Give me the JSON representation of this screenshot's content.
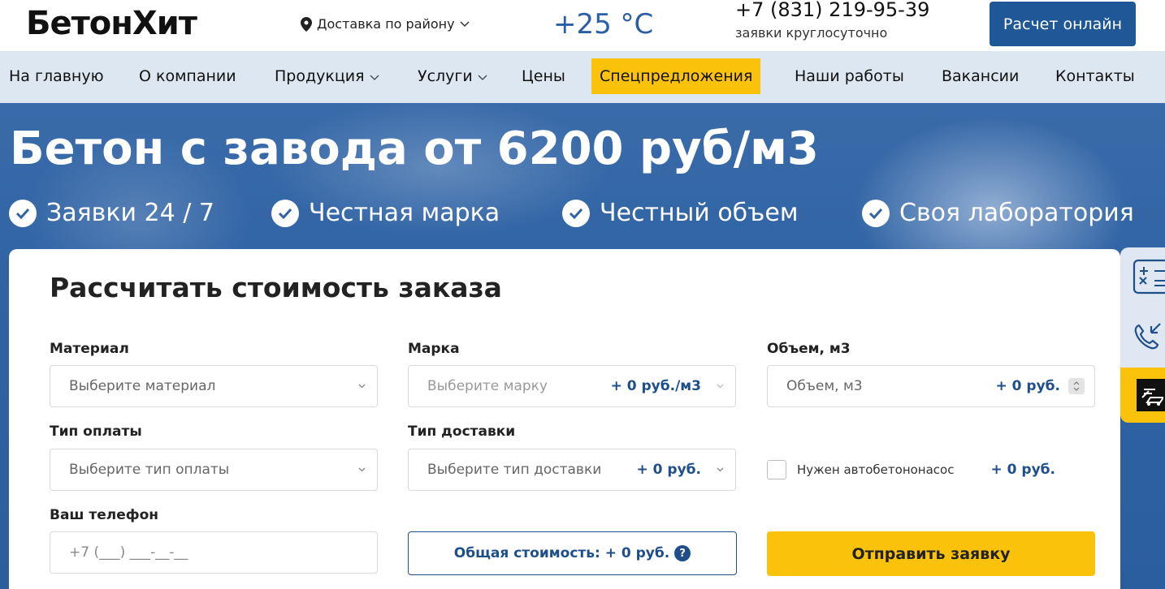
{
  "header": {
    "logo": "БетонХит",
    "delivery": "Доставка по району",
    "temperature": "+25 °C",
    "phone": "+7 (831) 219-95-39",
    "phone_note": "заявки круглосуточно",
    "calc_button": "Расчет онлайн"
  },
  "nav": {
    "items": [
      {
        "label": "На главную"
      },
      {
        "label": "О компании"
      },
      {
        "label": "Продукция"
      },
      {
        "label": "Услуги"
      },
      {
        "label": "Цены"
      },
      {
        "label": "Спецпредложения"
      },
      {
        "label": "Наши работы"
      },
      {
        "label": "Вакансии"
      },
      {
        "label": "Контакты"
      }
    ]
  },
  "hero": {
    "title": "Бетон с завода от 6200 руб/м3",
    "features": [
      "Заявки 24 / 7",
      "Честная марка",
      "Честный объем",
      "Своя лаборатория"
    ]
  },
  "form": {
    "title": "Рассчитать стоимость заказа",
    "material": {
      "label": "Материал",
      "placeholder": "Выберите материал"
    },
    "grade": {
      "label": "Марка",
      "placeholder": "Выберите марку",
      "price": "+ 0 руб./м3"
    },
    "volume": {
      "label": "Объем, м3",
      "placeholder": "Объем, м3",
      "price": "+ 0 руб."
    },
    "payment": {
      "label": "Тип оплаты",
      "placeholder": "Выберите тип оплаты"
    },
    "delivery_type": {
      "label": "Тип доставки",
      "placeholder": "Выберите тип доставки",
      "price": "+ 0 руб."
    },
    "pump": {
      "label": "Нужен автобетононасос",
      "price": "+ 0 руб."
    },
    "phone": {
      "label": "Ваш телефон",
      "placeholder": "+7 (___) ___-__-__"
    },
    "total": "Общая стоимость: + 0 руб.",
    "total_help": "?",
    "submit": "Отправить заявку"
  },
  "colors": {
    "brand_blue": "#1f5797",
    "accent_yellow": "#fbc20c",
    "nav_bg": "#dde7f1",
    "price_blue": "#1f4f8a"
  }
}
